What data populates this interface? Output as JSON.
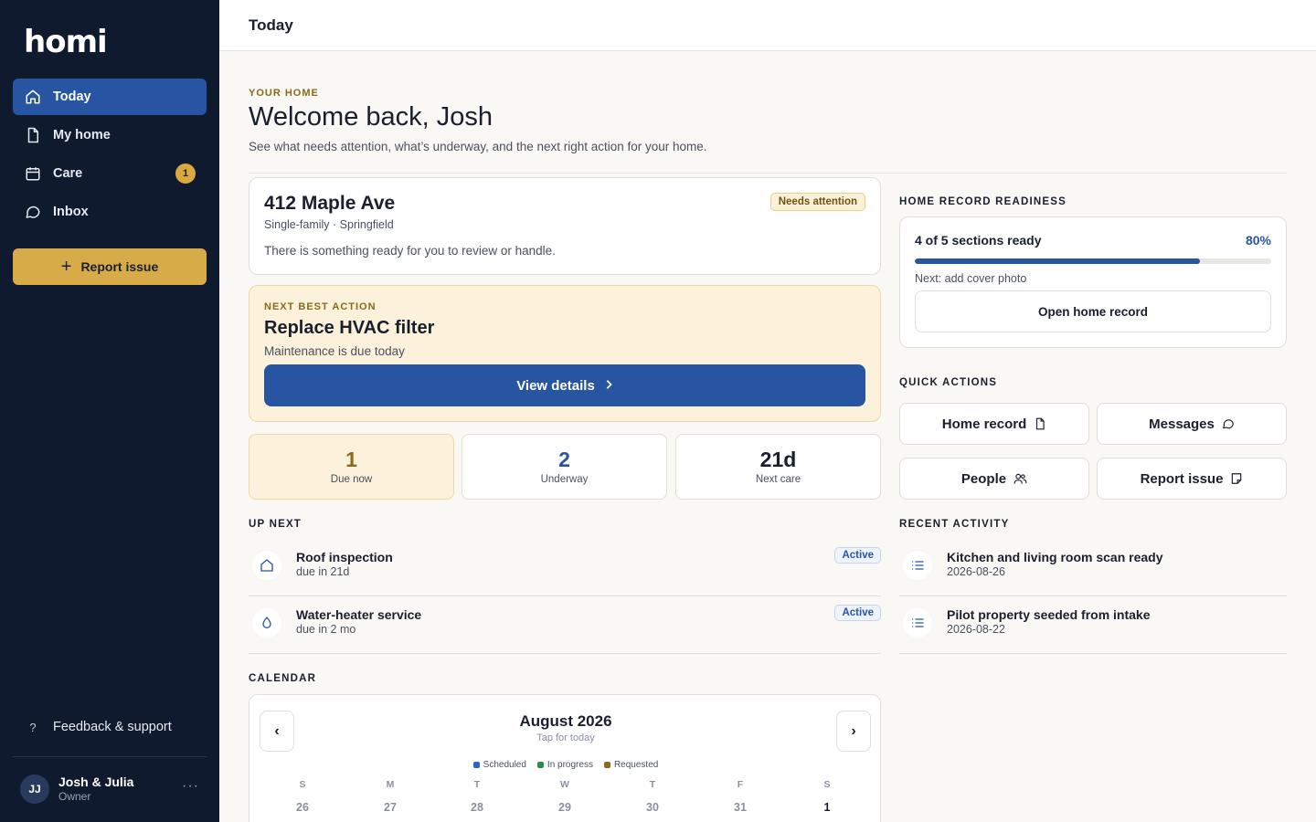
{
  "app": {
    "logo": "homi"
  },
  "sidebar": {
    "nav": [
      {
        "label": "Today",
        "icon": "home-icon",
        "active": true
      },
      {
        "label": "My home",
        "icon": "document-icon"
      },
      {
        "label": "Care",
        "icon": "calendar-icon",
        "badge": "1"
      },
      {
        "label": "Inbox",
        "icon": "chat-icon"
      }
    ],
    "report_button": "Report issue",
    "feedback": {
      "icon": "?",
      "label": "Feedback & support"
    },
    "user": {
      "initials": "JJ",
      "name": "Josh & Julia",
      "role": "Owner",
      "more": "···"
    }
  },
  "header": {
    "title": "Today"
  },
  "welcome": {
    "eyebrow": "YOUR HOME",
    "title": "Welcome back, Josh",
    "subtitle": "See what needs attention, what’s underway, and the next right action for your home."
  },
  "property": {
    "address": "412 Maple Ave",
    "details": "Single-family · Springfield",
    "status_badge": "Needs attention",
    "description": "There is something ready for you to review or handle."
  },
  "next_best_action": {
    "eyebrow": "NEXT BEST ACTION",
    "title": "Replace HVAC filter",
    "subtitle": "Maintenance is due today",
    "button": "View details"
  },
  "stats": [
    {
      "value": "1",
      "label": "Due now",
      "color": "#8a6a1c"
    },
    {
      "value": "2",
      "label": "Underway",
      "color": "#2855a2"
    },
    {
      "value": "21d",
      "label": "Next care",
      "color": "#1a1f2e"
    }
  ],
  "up_next": {
    "label": "UP NEXT",
    "items": [
      {
        "title": "Roof inspection",
        "due": "due in 21d",
        "status": "Active",
        "icon": "home-icon"
      },
      {
        "title": "Water-heater service",
        "due": "due in 2 mo",
        "status": "Active",
        "icon": "droplet-icon"
      }
    ]
  },
  "calendar": {
    "label": "CALENDAR",
    "month": "August 2026",
    "hint": "Tap for today",
    "prev": "‹",
    "next": "›",
    "legend": [
      {
        "label": "Scheduled",
        "color": "#2e63c4"
      },
      {
        "label": "In progress",
        "color": "#2f8a4e"
      },
      {
        "label": "Requested",
        "color": "#8a6a1c"
      }
    ],
    "weekdays": [
      "S",
      "M",
      "T",
      "W",
      "T",
      "F",
      "S"
    ],
    "first_row": [
      "26",
      "27",
      "28",
      "29",
      "30",
      "31",
      "1"
    ]
  },
  "readiness": {
    "label": "HOME RECORD READINESS",
    "title": "4 of 5 sections ready",
    "percent_text": "80%",
    "progress": 0.8,
    "next": "Next: add cover photo",
    "button": "Open home record"
  },
  "quick_actions": {
    "label": "QUICK ACTIONS",
    "items": [
      {
        "label": "Home record",
        "icon": "document-icon"
      },
      {
        "label": "Messages",
        "icon": "chat-icon"
      },
      {
        "label": "People",
        "icon": "people-icon"
      },
      {
        "label": "Report issue",
        "icon": "note-icon"
      }
    ]
  },
  "recent_activity": {
    "label": "RECENT ACTIVITY",
    "items": [
      {
        "title": "Kitchen and living room scan ready",
        "date": "2026-08-26",
        "icon": "list-icon"
      },
      {
        "title": "Pilot property seeded from intake",
        "date": "2026-08-22",
        "icon": "list-icon"
      }
    ]
  }
}
